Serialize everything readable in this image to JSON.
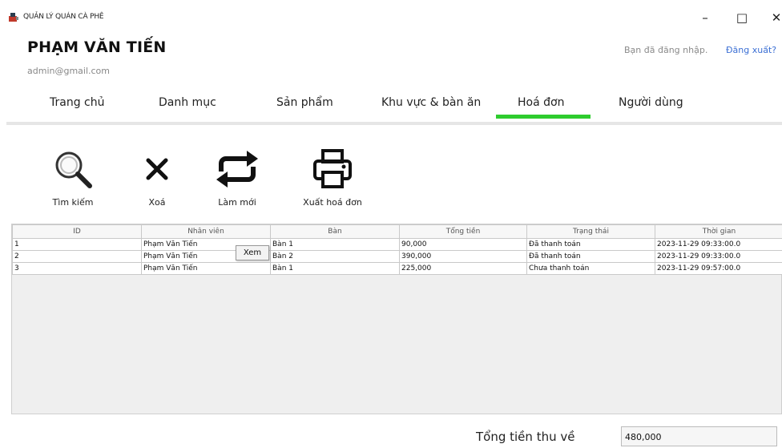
{
  "window": {
    "title": "QUẢN LÝ QUÁN CÀ PHÊ",
    "minimize": "–",
    "maximize": "□",
    "close": "✕"
  },
  "user": {
    "name": "PHẠM VĂN TIẾN",
    "email": "admin@gmail.com",
    "logged_in_text": "Bạn đã đăng nhập.",
    "logout": "Đăng xuất?"
  },
  "tabs": [
    {
      "label": "Trang chủ",
      "active": false
    },
    {
      "label": "Danh mục",
      "active": false
    },
    {
      "label": "Sản phẩm",
      "active": false
    },
    {
      "label": "Khu vực & bàn ăn",
      "active": false
    },
    {
      "label": "Hoá đơn",
      "active": true
    },
    {
      "label": "Người dùng",
      "active": false
    }
  ],
  "toolbar": {
    "search": {
      "label": "Tìm kiếm",
      "icon": "magnifier-icon"
    },
    "delete": {
      "label": "Xoá",
      "icon": "x-icon"
    },
    "refresh": {
      "label": "Làm mới",
      "icon": "refresh-icon"
    },
    "export": {
      "label": "Xuất hoá đơn",
      "icon": "printer-icon"
    }
  },
  "table": {
    "columns": [
      "ID",
      "Nhân viên",
      "Bàn",
      "Tổng tiền",
      "Trạng thái",
      "Thời gian"
    ],
    "rows": [
      [
        "1",
        "Phạm Văn Tiến",
        "Bàn 1",
        "90,000",
        "Đã thanh toán",
        "2023-11-29 09:33:00.0"
      ],
      [
        "2",
        "Phạm Văn Tiến",
        "Bàn 2",
        "390,000",
        "Đã thanh toán",
        "2023-11-29 09:33:00.0"
      ],
      [
        "3",
        "Phạm Văn Tiến",
        "Bàn 1",
        "225,000",
        "Chưa thanh toán",
        "2023-11-29 09:57:00.0"
      ]
    ]
  },
  "popup": {
    "label": "Xem"
  },
  "total": {
    "label": "Tổng tiền thu về",
    "value": "480,000"
  },
  "colors": {
    "accent_tab": "#2ecc2e",
    "link": "#3b6fd4"
  }
}
